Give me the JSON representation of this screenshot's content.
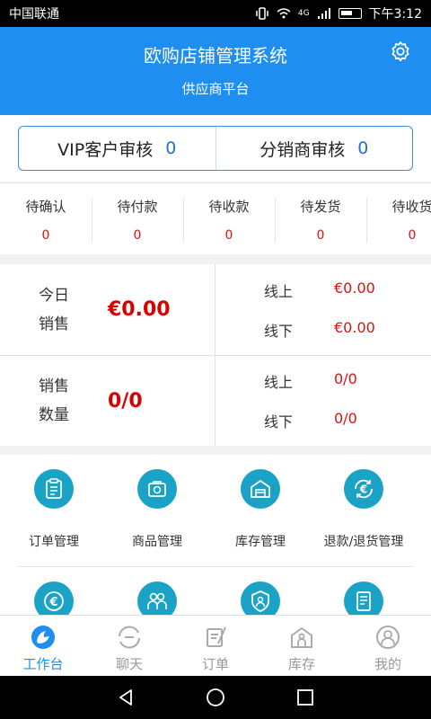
{
  "status_bar": {
    "carrier": "中国联通",
    "time": "下午3:12",
    "network": "4G"
  },
  "header": {
    "title": "欧购店铺管理系统",
    "subtitle": "供应商平台"
  },
  "audit": [
    {
      "label": "VIP客户审核",
      "count": "0"
    },
    {
      "label": "分销商审核",
      "count": "0"
    }
  ],
  "orders": [
    {
      "label": "待确认",
      "count": "0"
    },
    {
      "label": "待付款",
      "count": "0"
    },
    {
      "label": "待收款",
      "count": "0"
    },
    {
      "label": "待发货",
      "count": "0"
    },
    {
      "label": "待收货",
      "count": "0"
    }
  ],
  "stats": {
    "today_sales": {
      "label_line1": "今日",
      "label_line2": "销售",
      "value": "€0.00",
      "online_label": "线上",
      "online_value": "€0.00",
      "offline_label": "线下",
      "offline_value": "€0.00"
    },
    "sales_qty": {
      "label_line1": "销售",
      "label_line2": "数量",
      "value": "0/0",
      "online_label": "线上",
      "online_value": "0/0",
      "offline_label": "线下",
      "offline_value": "0/0"
    }
  },
  "menu": [
    {
      "label": "订单管理",
      "icon": "clipboard-icon"
    },
    {
      "label": "商品管理",
      "icon": "product-box-icon"
    },
    {
      "label": "库存管理",
      "icon": "warehouse-icon"
    },
    {
      "label": "退款/退货管理",
      "icon": "refund-euro-icon"
    }
  ],
  "menu_second_row_icons": [
    "euro-circle-icon",
    "users-icon",
    "shield-icon",
    "document-icon"
  ],
  "tabs": [
    {
      "label": "工作台",
      "icon": "workbench-icon",
      "active": true
    },
    {
      "label": "聊天",
      "icon": "chat-icon",
      "active": false
    },
    {
      "label": "订单",
      "icon": "order-icon",
      "active": false
    },
    {
      "label": "库存",
      "icon": "inventory-icon",
      "active": false
    },
    {
      "label": "我的",
      "icon": "profile-icon",
      "active": false
    }
  ],
  "colors": {
    "primary": "#1e8ef0",
    "icon_teal": "#1aa3c7",
    "value_red": "#d60000",
    "audit_border": "#3c8de6"
  }
}
